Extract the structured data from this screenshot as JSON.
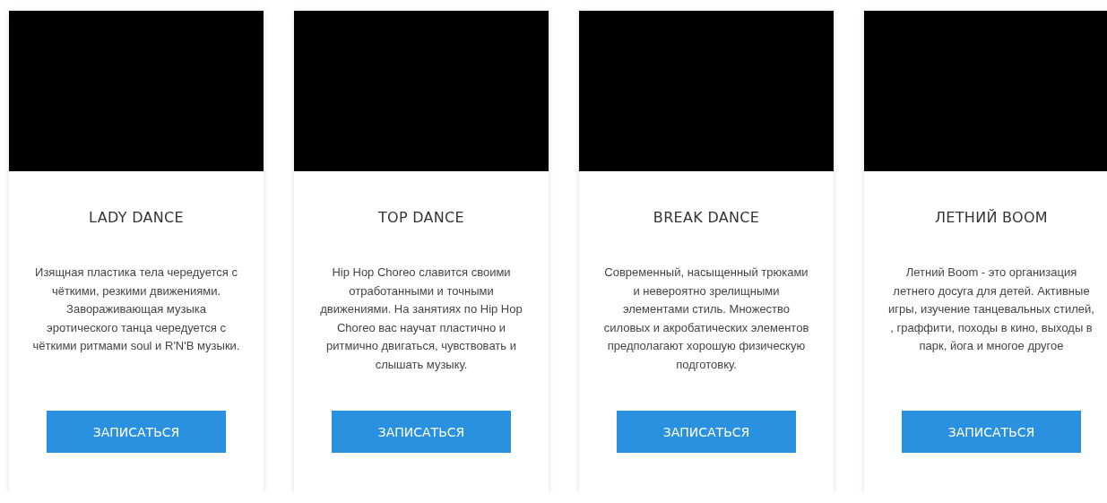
{
  "cards": [
    {
      "title": "LADY DANCE",
      "description": "Изящная пластика тела чередуется с чёткими, резкими движениями. Завораживающая музыка эротического танца чередуется с чёткими ритмами soul и R'N'B музыки.",
      "button": "ЗАПИСАТЬСЯ"
    },
    {
      "title": "TOP DANCE",
      "description": "Hip Hop Choreo славится своими отработанными и точными движениями. На занятиях по Hip Hop Choreo вас научат пластично и ритмично двигаться, чувствовать и слышать музыку.",
      "button": "ЗАПИСАТЬСЯ"
    },
    {
      "title": "BREAK DANCE",
      "description": "Современный, насыщенный трюками и невероятно зрелищными элементами стиль. Множество силовых и акробатических элементов предполагают хорошую физическую подготовку.",
      "button": "ЗАПИСАТЬСЯ"
    },
    {
      "title": "ЛЕТНИЙ BOOM",
      "description": "Летний Boom - это организация летнего досуга для детей. Активные игры, изучение танцевальных стилей, , граффити, походы в кино, выходы в парк, йога и многое другое",
      "button": "ЗАПИСАТЬСЯ"
    }
  ]
}
